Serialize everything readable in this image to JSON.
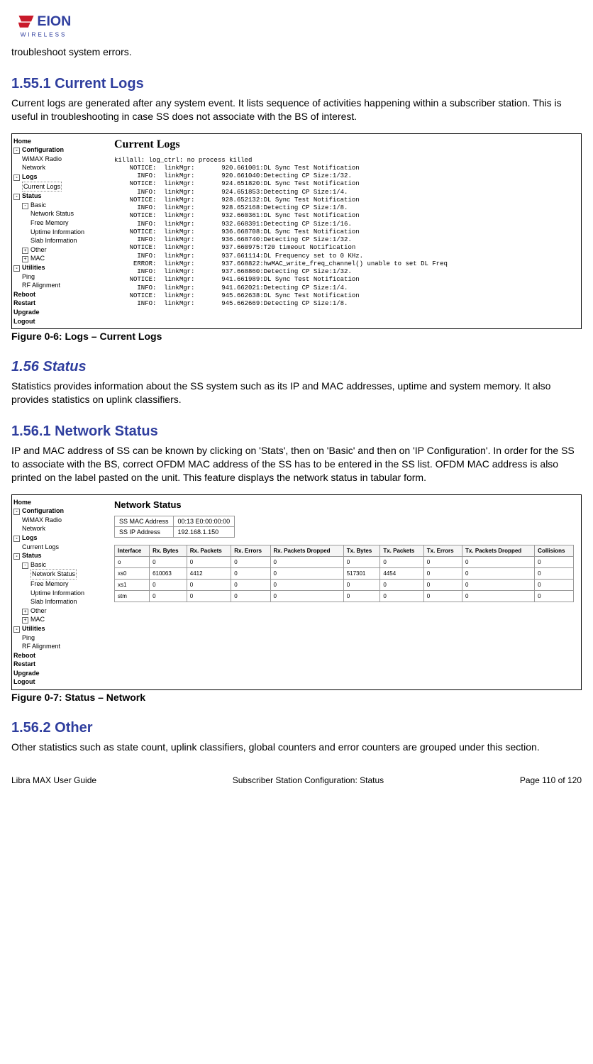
{
  "logo": {
    "brand": "EION",
    "sub": "WIRELESS"
  },
  "intro": "troubleshoot system errors.",
  "h_155_1": "1.55.1 Current Logs",
  "p_155_1": "Current logs are generated after any system event. It lists sequence of activities happening within a subscriber station. This is useful in troubleshooting in case SS does not associate with the BS of interest.",
  "nav": {
    "home": "Home",
    "config": "Configuration",
    "wimax": "WiMAX Radio",
    "network": "Network",
    "logs": "Logs",
    "current_logs": "Current Logs",
    "status": "Status",
    "basic": "Basic",
    "netstat": "Network Status",
    "freemem": "Free Memory",
    "uptime": "Uptime Information",
    "slab": "Slab Information",
    "other": "Other",
    "mac": "MAC",
    "utilities": "Utilities",
    "ping": "Ping",
    "rfalign": "RF Alignment",
    "reboot": "Reboot",
    "restart": "Restart",
    "upgrade": "Upgrade",
    "logout": "Logout"
  },
  "currentLogs": {
    "title": "Current Logs",
    "lines": [
      "killall: log_ctrl: no process killed",
      "    NOTICE:  linkMgr:       920.661001:DL Sync Test Notification",
      "      INFO:  linkMgr:       920.661040:Detecting CP Size:1/32.",
      "    NOTICE:  linkMgr:       924.651820:DL Sync Test Notification",
      "      INFO:  linkMgr:       924.651853:Detecting CP Size:1/4.",
      "    NOTICE:  linkMgr:       928.652132:DL Sync Test Notification",
      "      INFO:  linkMgr:       928.652168:Detecting CP Size:1/8.",
      "    NOTICE:  linkMgr:       932.660361:DL Sync Test Notification",
      "      INFO:  linkMgr:       932.668391:Detecting CP Size:1/16.",
      "    NOTICE:  linkMgr:       936.668708:DL Sync Test Notification",
      "      INFO:  linkMgr:       936.668740:Detecting CP Size:1/32.",
      "    NOTICE:  linkMgr:       937.660975:T20 timeout Notification",
      "      INFO:  linkMgr:       937.661114:DL Frequency set to 0 KHz.",
      "     ERROR:  linkMgr:       937.668822:hwMAC_write_freq_channel() unable to set DL Freq",
      "      INFO:  linkMgr:       937.668860:Detecting CP Size:1/32.",
      "    NOTICE:  linkMgr:       941.661989:DL Sync Test Notification",
      "      INFO:  linkMgr:       941.662021:Detecting CP Size:1/4.",
      "    NOTICE:  linkMgr:       945.662638:DL Sync Test Notification",
      "      INFO:  linkMgr:       945.662669:Detecting CP Size:1/8."
    ]
  },
  "cap_06": "Figure 0-6: Logs – Current Logs",
  "h_156": "1.56 Status",
  "p_156": "Statistics provides information about the SS system such as its IP and MAC addresses, uptime and system memory. It also provides statistics on uplink classifiers.",
  "h_156_1": "1.56.1 Network Status",
  "p_156_1": "IP and MAC address of SS can be known by clicking on 'Stats', then on 'Basic' and then on 'IP Configuration'. In order for the SS to associate with the BS, correct OFDM MAC address of the SS has to be entered in the SS list. OFDM MAC address is also printed on the label pasted on the unit. This feature displays the network status in tabular form.",
  "netStatus": {
    "title": "Network Status",
    "mac_label": "SS MAC Address",
    "mac_val": "00:13 E0:00:00:00",
    "ip_label": "SS IP Address",
    "ip_val": "192.168.1.150",
    "cols": [
      "Interface",
      "Rx. Bytes",
      "Rx. Packets",
      "Rx. Errors",
      "Rx. Packets Dropped",
      "Tx. Bytes",
      "Tx. Packets",
      "Tx. Errors",
      "Tx. Packets Dropped",
      "Collisions"
    ],
    "rows": [
      [
        "o",
        "0",
        "0",
        "0",
        "0",
        "0",
        "0",
        "0",
        "0",
        "0"
      ],
      [
        "xs0",
        "610063",
        "4412",
        "0",
        "0",
        "517301",
        "4454",
        "0",
        "0",
        "0"
      ],
      [
        "xs1",
        "0",
        "0",
        "0",
        "0",
        "0",
        "0",
        "0",
        "0",
        "0"
      ],
      [
        "stm",
        "0",
        "0",
        "0",
        "0",
        "0",
        "0",
        "0",
        "0",
        "0"
      ]
    ]
  },
  "cap_07": "Figure 0-7: Status – Network",
  "h_156_2": "1.56.2 Other",
  "p_156_2": "Other statistics such as state count, uplink classifiers, global counters and error counters are grouped under this section.",
  "footer": {
    "left": "Libra MAX User Guide",
    "center": "Subscriber Station Configuration: Status",
    "right": "Page 110 of 120"
  }
}
